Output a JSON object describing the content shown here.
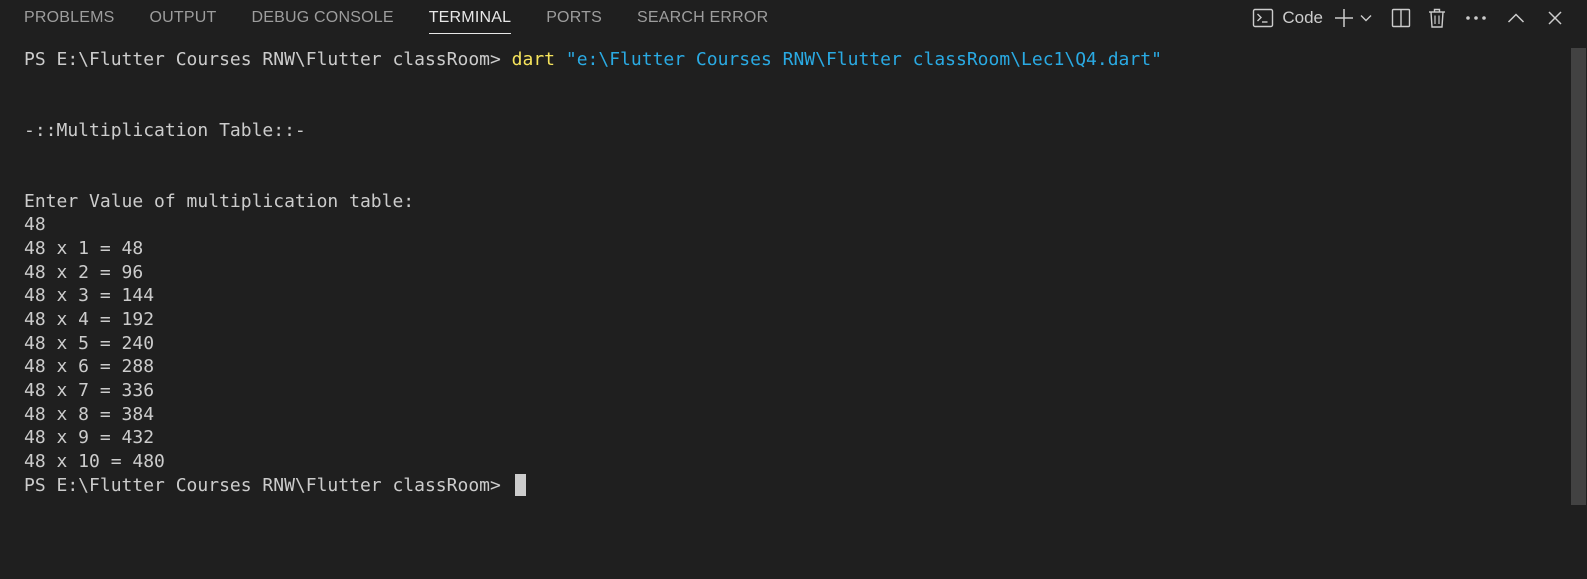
{
  "tabs": [
    {
      "label": "PROBLEMS",
      "active": false
    },
    {
      "label": "OUTPUT",
      "active": false
    },
    {
      "label": "DEBUG CONSOLE",
      "active": false
    },
    {
      "label": "TERMINAL",
      "active": true
    },
    {
      "label": "PORTS",
      "active": false
    },
    {
      "label": "SEARCH ERROR",
      "active": false
    }
  ],
  "actions": {
    "profile_icon": "terminal-icon",
    "profile_label": "Code",
    "new_terminal_icon": "plus-icon",
    "dropdown_icon": "chevron-down-icon",
    "split_icon": "split-icon",
    "kill_icon": "trash-icon",
    "more_icon": "ellipsis-icon",
    "maximize_icon": "chevron-up-icon",
    "close_icon": "close-icon"
  },
  "terminal": {
    "command_line": {
      "prompt": "PS E:\\Flutter Courses RNW\\Flutter classRoom> ",
      "command": "dart",
      "argument": "\"e:\\Flutter Courses RNW\\Flutter classRoom\\Lec1\\Q4.dart\""
    },
    "output_lines": [
      "",
      "",
      "-::Multiplication Table::-",
      "",
      "",
      "Enter Value of multiplication table:",
      "48",
      "48 x 1 = 48",
      "48 x 2 = 96",
      "48 x 3 = 144",
      "48 x 4 = 192",
      "48 x 5 = 240",
      "48 x 6 = 288",
      "48 x 7 = 336",
      "48 x 8 = 384",
      "48 x 9 = 432",
      "48 x 10 = 480"
    ],
    "final_prompt": "PS E:\\Flutter Courses RNW\\Flutter classRoom> "
  },
  "colors": {
    "background": "#1f1f1f",
    "text": "#cccccc",
    "command": "#f5e35c",
    "string": "#2aaae3",
    "active_tab": "#e7e7e7",
    "inactive_tab": "#9d9d9d"
  }
}
